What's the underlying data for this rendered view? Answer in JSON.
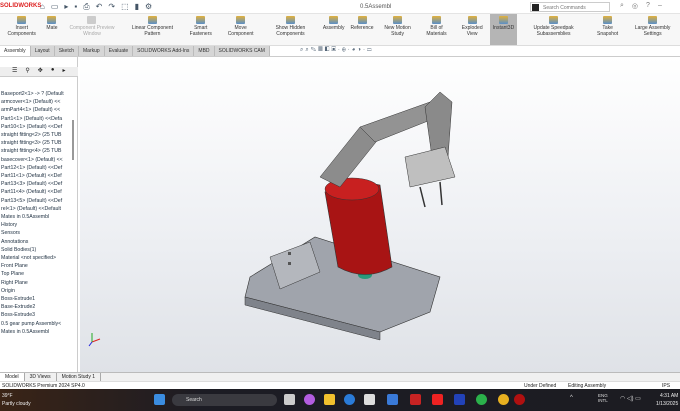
{
  "app": {
    "brand": "SOLIDWORKS",
    "title": "0.5Assembl"
  },
  "search": {
    "placeholder": "Search Commands"
  },
  "ribbon": [
    {
      "label": "Insert Components",
      "state": "normal"
    },
    {
      "label": "Mate",
      "state": "normal"
    },
    {
      "label": "Component Preview Window",
      "state": "disabled"
    },
    {
      "label": "Linear Component Pattern",
      "state": "normal"
    },
    {
      "label": "Smart Fasteners",
      "state": "normal"
    },
    {
      "label": "Move Component",
      "state": "normal"
    },
    {
      "label": "Show Hidden Components",
      "state": "normal"
    },
    {
      "label": "Assembly",
      "state": "normal"
    },
    {
      "label": "Reference",
      "state": "normal"
    },
    {
      "label": "New Motion Study",
      "state": "normal"
    },
    {
      "label": "Bill of Materials",
      "state": "normal"
    },
    {
      "label": "Exploded View",
      "state": "normal"
    },
    {
      "label": "Instant3D",
      "state": "active"
    },
    {
      "label": "Update Speedpak Subassemblies",
      "state": "normal"
    },
    {
      "label": "Take Snapshot",
      "state": "normal"
    },
    {
      "label": "Large Assembly Settings",
      "state": "normal"
    }
  ],
  "tabs": [
    "Assembly",
    "Layout",
    "Sketch",
    "Markup",
    "Evaluate",
    "SOLIDWORKS Add-Ins",
    "MBD",
    "SOLIDWORKS CAM"
  ],
  "tree": [
    "Baseport2<1> -> ? (Default",
    "armcover<1> (Default) <<",
    "armPart4<1> (Default) <<",
    "Part1<1> (Default) <<Defa",
    "Part10<1> (Default) <<Def",
    "straight fitting<2> (25 TUB",
    "straight fitting<3> (25 TUB",
    "straight fitting<4> (25 TUB",
    "basecover<1> (Default) <<",
    "Part12<1> (Default) <<Def",
    "Part11<1> (Default) <<Def",
    "Part13<3> (Default) <<Def",
    "Part11<4> (Default) <<Def",
    "Part13<5> (Default) <<Def",
    "rel<1> (Default) <<Default",
    "Mates in 0.5Assembl",
    "History",
    "Sensors",
    "Annotations",
    "Solid Bodies(1)",
    "Material <not specified>",
    "Front Plane",
    "Top Plane",
    "Right Plane",
    "Origin",
    "Boss-Extrude1",
    "Base-Extrude2",
    "Boss-Extrude3",
    "0.5 gear pump Assembly<",
    "Mates in 0.5Assembl"
  ],
  "bottom_tabs": [
    "Model",
    "3D Views",
    "Motion Study 1"
  ],
  "status": {
    "left": "SOLIDWORKS Premium 2024 SP4.0",
    "defined": "Under Defined",
    "mode": "Editing Assembly",
    "units": "IPS"
  },
  "taskbar": {
    "weather_temp": "39°F",
    "weather_desc": "Partly cloudy",
    "search": "Search",
    "lang": "ENG INTL",
    "time": "4:31 AM",
    "date": "1/13/2025"
  },
  "colors": {
    "accent": "#d22222",
    "body_red": "#b01515",
    "arm_gray": "#8c8c8c"
  }
}
